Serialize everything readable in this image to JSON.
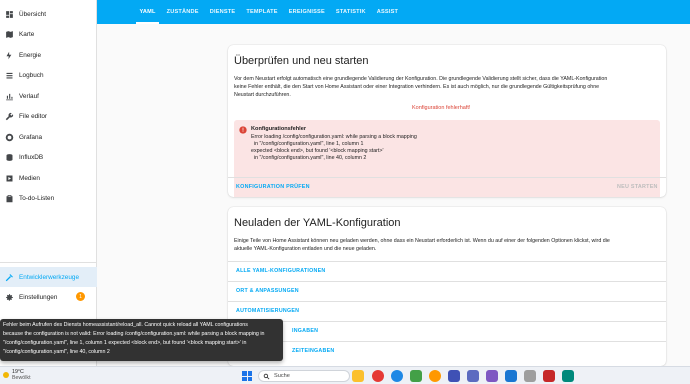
{
  "sidebar": {
    "items": [
      {
        "label": "Übersicht",
        "icon": "dashboard-icon"
      },
      {
        "label": "Karte",
        "icon": "map-icon"
      },
      {
        "label": "Energie",
        "icon": "lightning-icon"
      },
      {
        "label": "Logbuch",
        "icon": "list-icon"
      },
      {
        "label": "Verlauf",
        "icon": "chart-icon"
      },
      {
        "label": "File editor",
        "icon": "wrench-icon"
      },
      {
        "label": "Grafana",
        "icon": "grafana-icon"
      },
      {
        "label": "InfluxDB",
        "icon": "database-icon"
      },
      {
        "label": "Medien",
        "icon": "media-icon"
      },
      {
        "label": "To-do-Listen",
        "icon": "clipboard-icon"
      }
    ],
    "dev_tools": "Entwicklerwerkzeuge",
    "settings": "Einstellungen",
    "settings_badge": "1"
  },
  "tabs": [
    "YAML",
    "ZUSTÄNDE",
    "DIENSTE",
    "TEMPLATE",
    "EREIGNISSE",
    "STATISTIK",
    "ASSIST"
  ],
  "restart_card": {
    "title": "Überprüfen und neu starten",
    "desc_lines": [
      "Vor dem Neustart erfolgt automatisch eine grundlegende Validierung der Konfiguration. Die grundlegende Validierung stellt sicher, dass die YAML-Konfiguration",
      "keine Fehler enthält, die den Start von Home Assistant oder einer Integration verhindern. Es ist auch möglich, nur die grundlegende Gültigkeitsprüfung ohne",
      "Neustart durchzuführen."
    ],
    "error_status": "Konfiguration fehlerhaft!",
    "alert_title": "Konfigurationsfehler",
    "alert_lines": [
      "Error loading /config/configuration.yaml: while parsing a block mapping",
      "  in \"/config/configuration.yaml\", line 1, column 1",
      "expected <block end>, but found '<block mapping start>'",
      "  in \"/config/configuration.yaml\", line 40, column 2"
    ],
    "check_button": "KONFIGURATION PRÜFEN",
    "restart_button": "NEU STARTEN"
  },
  "reload_card": {
    "title": "Neuladen der YAML-Konfiguration",
    "desc_lines": [
      "Einige Teile von Home Assistant können neu geladen werden, ohne dass ein Neustart erforderlich ist. Wenn du auf einer der folgenden Optionen klickst, wird die",
      "aktuelle YAML-Konfiguration entladen und die neue geladen."
    ],
    "items": [
      "ALLE YAML-KONFIGURATIONEN",
      "ORT & ANPASSUNGEN",
      "AUTOMATISIERUNGEN",
      "SZENEN",
      "ZEITEINGABEN"
    ],
    "items_visible": [
      "ALLE YAML-KONFIGURATIONEN",
      "ORT & ANPASSUNGEN",
      "AUTOMATISIERUNGEN",
      "INGABEN",
      "ZEITEINGABEN"
    ]
  },
  "toast": {
    "lines": [
      "Fehler beim Aufrufen des Diensts homeassistant/reload_all. Cannot quick reload all YAML configurations",
      "because the configuration is not valid: Error loading /config/configuration.yaml: while parsing a block mapping in",
      "\"/config/configuration.yaml\", line 1, column 1 expected <block end>, but found '<block mapping start>' in",
      "\"/config/configuration.yaml\", line 40, column 2"
    ]
  },
  "taskbar": {
    "temperature": "19°C",
    "condition": "Bewölkt",
    "search_placeholder": "Suche"
  }
}
